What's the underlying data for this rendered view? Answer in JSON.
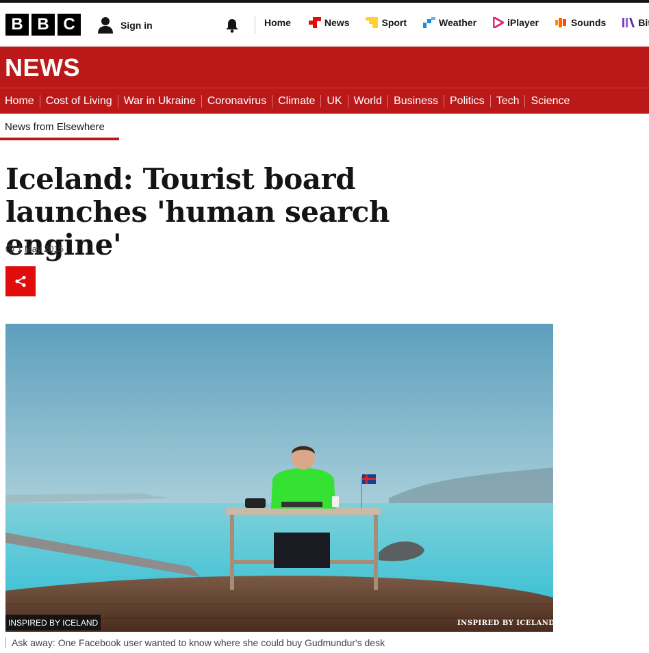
{
  "global_nav": {
    "logo": [
      "B",
      "B",
      "C"
    ],
    "sign_in": "Sign in",
    "items": [
      {
        "label": "Home",
        "icon": "",
        "color": ""
      },
      {
        "label": "News",
        "icon": "news-icon",
        "color": "#e10c0c"
      },
      {
        "label": "Sport",
        "icon": "sport-icon",
        "color": "#ffd230"
      },
      {
        "label": "Weather",
        "icon": "weather-icon",
        "color": "#1c8bde"
      },
      {
        "label": "iPlayer",
        "icon": "iplayer-icon",
        "color": "#e6257c"
      },
      {
        "label": "Sounds",
        "icon": "sounds-icon",
        "color": "#ff6b00"
      },
      {
        "label": "Bit",
        "icon": "bitesize-icon",
        "color": "#7b3ec6"
      }
    ]
  },
  "news_header": {
    "title": "NEWS",
    "nav": [
      "Home",
      "Cost of Living",
      "War in Ukraine",
      "Coronavirus",
      "Climate",
      "UK",
      "World",
      "Business",
      "Politics",
      "Tech",
      "Science"
    ],
    "subnav": "News from Elsewhere"
  },
  "article": {
    "headline": "Iceland: Tourist board launches 'human search engine'",
    "date": "1 May 2015",
    "share_icon": "share-icon",
    "image": {
      "credit": "INSPIRED BY ICELAND",
      "watermark": "INSPIRED BY ICELAND",
      "caption": "Ask away: One Facebook user wanted to know where she could buy Gudmundur's desk"
    }
  },
  "colors": {
    "brand_red": "#bb1919",
    "share_red": "#e10c0c"
  }
}
